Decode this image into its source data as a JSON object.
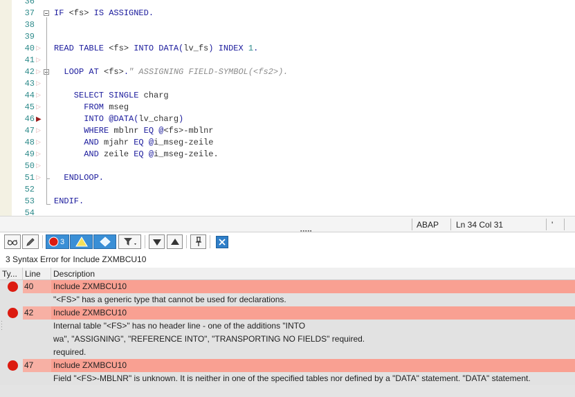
{
  "editor": {
    "lines": [
      {
        "num": "36",
        "marker": "",
        "segments": []
      },
      {
        "num": "37",
        "marker": "",
        "fold": true,
        "segments": [
          {
            "t": "IF ",
            "c": "k"
          },
          {
            "t": "<fs>",
            "c": "v"
          },
          {
            "t": " IS ASSIGNED.",
            "c": "k"
          }
        ]
      },
      {
        "num": "38",
        "marker": "",
        "segments": []
      },
      {
        "num": "39",
        "marker": "",
        "segments": []
      },
      {
        "num": "40",
        "marker": "▷",
        "segments": [
          {
            "t": "READ TABLE ",
            "c": "k"
          },
          {
            "t": "<fs>",
            "c": "v"
          },
          {
            "t": " INTO DATA(",
            "c": "k"
          },
          {
            "t": "lv_fs",
            "c": "v"
          },
          {
            "t": ") INDEX ",
            "c": "k"
          },
          {
            "t": "1",
            "c": "n"
          },
          {
            "t": ".",
            "c": "k"
          }
        ]
      },
      {
        "num": "41",
        "marker": "▷",
        "segments": []
      },
      {
        "num": "42",
        "marker": "▷",
        "fold": true,
        "segments": [
          {
            "t": "  LOOP AT ",
            "c": "k"
          },
          {
            "t": "<fs>",
            "c": "v"
          },
          {
            "t": ".",
            "c": "k"
          },
          {
            "t": "\" ASSIGNING FIELD-SYMBOL(<fs2>).",
            "c": "c"
          }
        ]
      },
      {
        "num": "43",
        "marker": "▷",
        "segments": []
      },
      {
        "num": "44",
        "marker": "▷",
        "segments": [
          {
            "t": "    SELECT SINGLE ",
            "c": "k"
          },
          {
            "t": "charg",
            "c": "v"
          }
        ]
      },
      {
        "num": "45",
        "marker": "▷",
        "segments": [
          {
            "t": "      FROM ",
            "c": "k"
          },
          {
            "t": "mseg",
            "c": "v"
          }
        ]
      },
      {
        "num": "46",
        "marker": "▶",
        "bp": true,
        "segments": [
          {
            "t": "      INTO @DATA(",
            "c": "k"
          },
          {
            "t": "lv_charg",
            "c": "v"
          },
          {
            "t": ")",
            "c": "k"
          }
        ]
      },
      {
        "num": "47",
        "marker": "▷",
        "segments": [
          {
            "t": "      WHERE ",
            "c": "k"
          },
          {
            "t": "mblnr",
            "c": "v"
          },
          {
            "t": " EQ @",
            "c": "k"
          },
          {
            "t": "<fs>",
            "c": "v"
          },
          {
            "t": "-mblnr",
            "c": "v"
          }
        ]
      },
      {
        "num": "48",
        "marker": "▷",
        "segments": [
          {
            "t": "      AND ",
            "c": "k"
          },
          {
            "t": "mjahr",
            "c": "v"
          },
          {
            "t": " EQ @",
            "c": "k"
          },
          {
            "t": "i_mseg-zeile",
            "c": "v"
          }
        ]
      },
      {
        "num": "49",
        "marker": "▷",
        "segments": [
          {
            "t": "      AND ",
            "c": "k"
          },
          {
            "t": "zeile",
            "c": "v"
          },
          {
            "t": " EQ @",
            "c": "k"
          },
          {
            "t": "i_mseg-zeile.",
            "c": "v"
          }
        ]
      },
      {
        "num": "50",
        "marker": "▷",
        "segments": []
      },
      {
        "num": "51",
        "marker": "▷",
        "segments": [
          {
            "t": "  ENDLOOP.",
            "c": "k"
          }
        ]
      },
      {
        "num": "52",
        "marker": "",
        "segments": []
      },
      {
        "num": "53",
        "marker": "",
        "segments": [
          {
            "t": "ENDIF.",
            "c": "k"
          }
        ]
      },
      {
        "num": "54",
        "marker": "",
        "segments": []
      }
    ]
  },
  "status_bar": {
    "language": "ABAP",
    "position": "Ln  34 Col  31",
    "extra": "'"
  },
  "toolbar": {
    "error_count": "3",
    "icons": [
      "glasses-icon",
      "pencil-icon",
      "error-filter-icon",
      "warning-filter-icon",
      "info-filter-icon",
      "funnel-icon",
      "arrow-down-icon",
      "arrow-up-icon",
      "pin-icon",
      "close-icon"
    ]
  },
  "messages": {
    "title": "3 Syntax Error for Include ZXMBCU10",
    "columns": {
      "type": "Ty...",
      "line": "Line",
      "description": "Description"
    },
    "errors": [
      {
        "line": "40",
        "include": "Include ZXMBCU10",
        "details": [
          "\"<FS>\" has a generic type that cannot be used for declarations."
        ]
      },
      {
        "line": "42",
        "include": "Include ZXMBCU10",
        "details": [
          "Internal table \"<FS>\" has no header line - one of the additions \"INTO",
          "wa\", \"ASSIGNING\", \"REFERENCE INTO\", \"TRANSPORTING NO FIELDS\" required.",
          "required."
        ]
      },
      {
        "line": "47",
        "include": "Include ZXMBCU10",
        "details": [
          "Field \"<FS>-MBLNR\" is unknown. It is neither in one of the specified tables nor defined by a \"DATA\" statement. \"DATA\" statement."
        ]
      }
    ]
  },
  "colors": {
    "error_row": "#f9a092",
    "error_dot": "#dc1b10",
    "keyword": "#1a1a9c",
    "line_number": "#2e8b8b"
  }
}
